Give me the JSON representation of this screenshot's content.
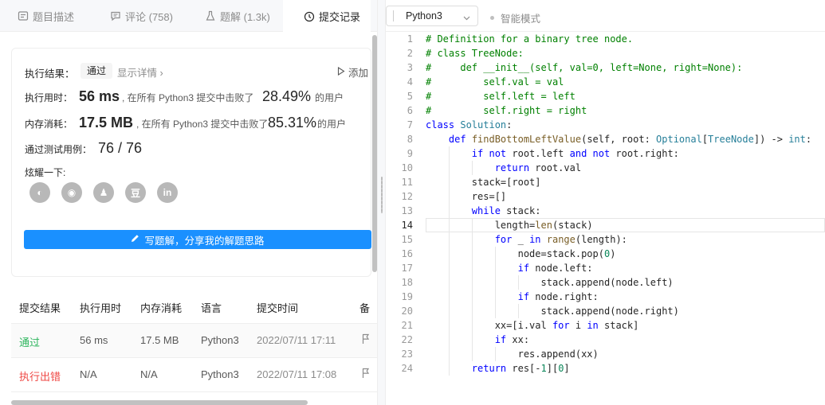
{
  "tabs": [
    {
      "label": "题目描述",
      "icon": "document-icon"
    },
    {
      "label": "评论 (758)",
      "icon": "comment-icon"
    },
    {
      "label": "题解 (1.3k)",
      "icon": "flask-icon"
    },
    {
      "label": "提交记录",
      "icon": "clock-icon"
    }
  ],
  "result": {
    "label": "执行结果：",
    "status": "通过",
    "detail_link": "显示详情 ›",
    "add_label": "添加",
    "runtime_label": "执行用时：",
    "runtime_value": "56 ms",
    "runtime_text": ", 在所有 Python3 提交中击败了",
    "runtime_pct": "28.49%",
    "runtime_suffix": "的用户",
    "memory_label": "内存消耗：",
    "memory_value": "17.5 MB",
    "memory_text": ", 在所有 Python3 提交中击败了",
    "memory_pct": "85.31%",
    "memory_suffix": "的用户",
    "tests_label": "通过测试用例：",
    "tests_value": "76 / 76",
    "share_label": "炫耀一下:",
    "share_icons": [
      {
        "name": "wechat-icon",
        "glyph": "◐"
      },
      {
        "name": "weibo-icon",
        "glyph": "◉"
      },
      {
        "name": "qq-icon",
        "glyph": "♟"
      },
      {
        "name": "douban-icon",
        "glyph": "豆"
      },
      {
        "name": "linkedin-icon",
        "glyph": "in"
      }
    ],
    "write_button": "写题解，分享我的解题思路"
  },
  "submissions": {
    "headers": [
      "提交结果",
      "执行用时",
      "内存消耗",
      "语言",
      "提交时间",
      "备"
    ],
    "rows": [
      {
        "status": "通过",
        "status_type": "ok",
        "runtime": "56 ms",
        "memory": "17.5 MB",
        "language": "Python3",
        "time": "2022/07/11 17:11"
      },
      {
        "status": "执行出错",
        "status_type": "err",
        "runtime": "N/A",
        "memory": "N/A",
        "language": "Python3",
        "time": "2022/07/11 17:08"
      }
    ]
  },
  "editor": {
    "language": "Python3",
    "smart_mode": "智能模式",
    "current_line": 14
  },
  "colors": {
    "accent": "#1a90ff",
    "ok": "#2db55d",
    "err": "#ef4743"
  }
}
